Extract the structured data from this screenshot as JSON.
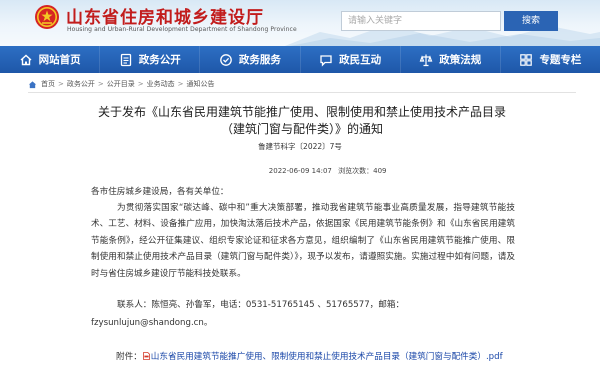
{
  "header": {
    "site_title": "山东省住房和城乡建设厅",
    "site_subtitle": "Housing and Urban-Rural Development Department of Shandong Province",
    "search_placeholder": "请输入关键字",
    "search_button": "搜索",
    "brand_color": "#c21c1c",
    "accent_color": "#2b64b4"
  },
  "nav": {
    "items": [
      {
        "label": "网站首页",
        "icon": "home-icon"
      },
      {
        "label": "政务公开",
        "icon": "government-info-icon"
      },
      {
        "label": "政务服务",
        "icon": "service-icon"
      },
      {
        "label": "政民互动",
        "icon": "interaction-icon"
      },
      {
        "label": "政策法规",
        "icon": "policy-icon"
      },
      {
        "label": "专题专栏",
        "icon": "topic-icon"
      }
    ]
  },
  "breadcrumb": {
    "items": [
      "首页",
      "政务公开",
      "公开目录",
      "业务动态",
      "通知公告"
    ],
    "separator": ">"
  },
  "article": {
    "title": "关于发布《山东省民用建筑节能推广使用、限制使用和禁止使用技术产品目录（建筑门窗与配件类）》的通知",
    "doc_number": "鲁建节科字〔2022〕7号",
    "date": "2022-06-09 14:07",
    "views_label": "浏览次数：",
    "views": "409",
    "greeting": "各市住房城乡建设局，各有关单位：",
    "paragraph": "为贯彻落实国家“碳达峰、碳中和”重大决策部署，推动我省建筑节能事业高质量发展，指导建筑节能技术、工艺、材料、设备推广应用，加快淘汰落后技术产品，依据国家《民用建筑节能条例》和《山东省民用建筑节能条例》，经公开征集建议、组织专家论证和征求各方意见，组织编制了《山东省民用建筑节能推广使用、限制使用和禁止使用技术产品目录（建筑门窗与配件类）》，现予以发布，请遵照实施。实施过程中如有问题，请及时与省住房城乡建设厅节能科技处联系。",
    "contact_line": "联系人：陈恒亮、孙鲁军，电话：0531-51765145 、51765577，邮箱：",
    "contact_email": "fzysunlujun@shandong.cn。",
    "attachment_label": "附件：",
    "attachment_name": "山东省民用建筑节能推广使用、限制使用和禁止使用技术产品目录（建筑门窗与配件类）.pdf",
    "attachment_icon": "pdf-icon"
  }
}
